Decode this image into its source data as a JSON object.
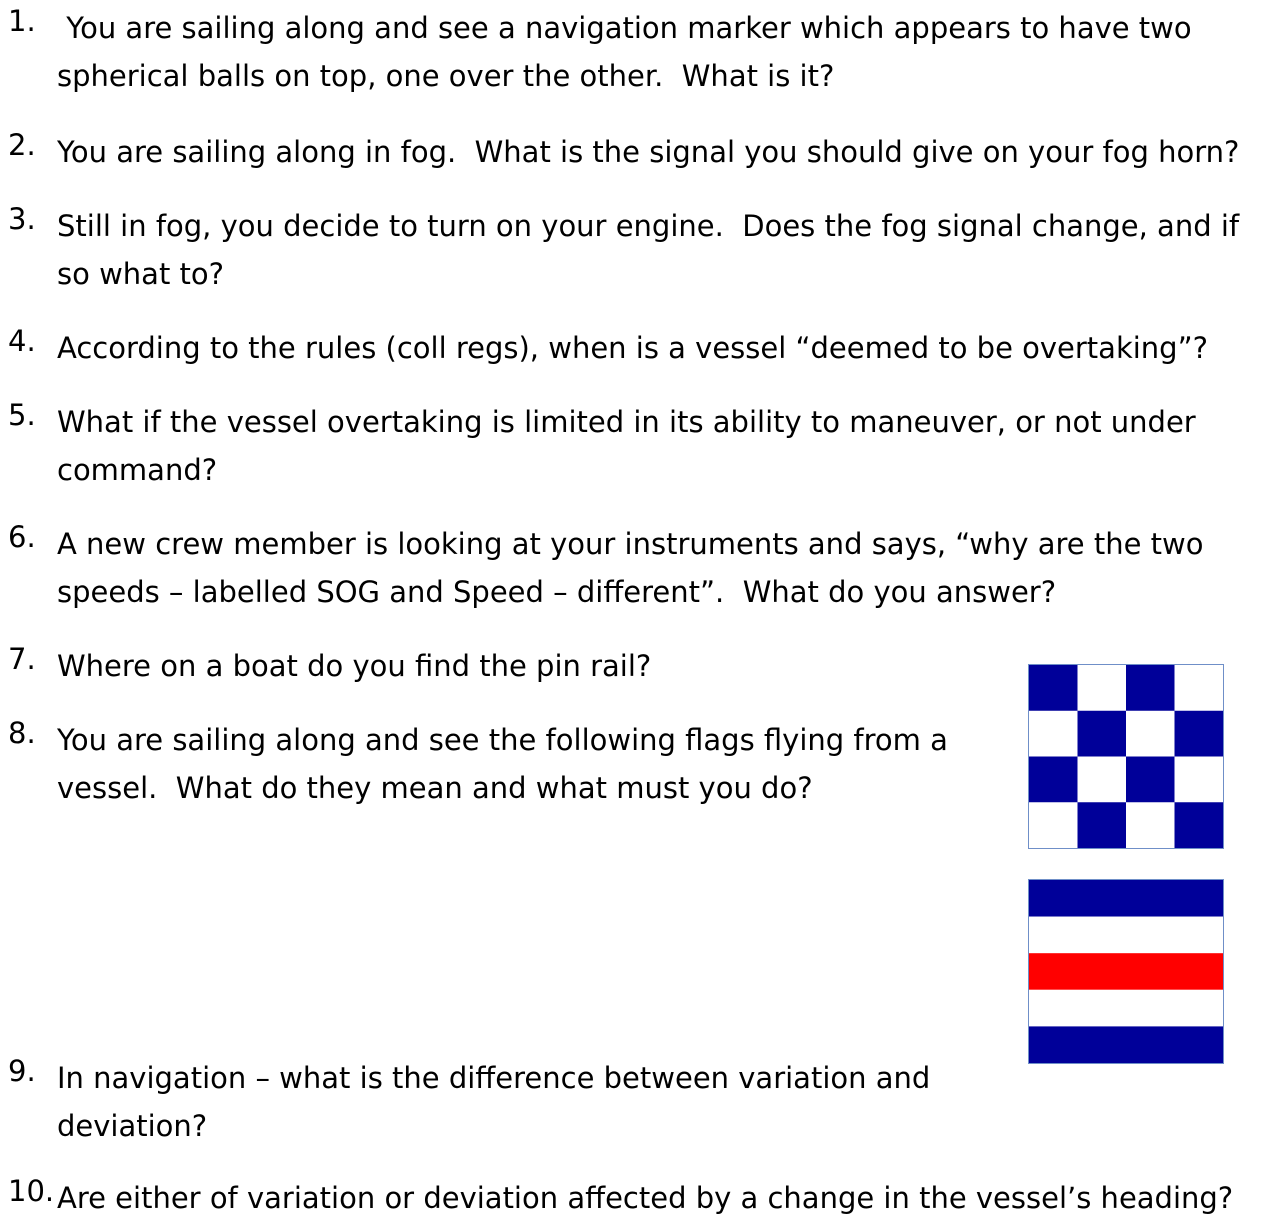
{
  "questions": [
    {
      "number": "1.",
      "lines": [
        " You are sailing along and see a navigation marker which appears to have two",
        "spherical balls on top, one over the other.  What is it?"
      ]
    },
    {
      "number": "2.",
      "lines": [
        "You are sailing along in fog.  What is the signal you should give on your fog horn?"
      ]
    },
    {
      "number": "3.",
      "lines": [
        "Still in fog, you decide to turn on your engine.  Does the fog signal change, and if",
        "so what to?"
      ]
    },
    {
      "number": "4.",
      "lines": [
        "According to the rules (coll regs), when is a vessel “deemed to be overtaking”?"
      ]
    },
    {
      "number": "5.",
      "lines": [
        "What if the vessel overtaking is limited in its ability to maneuver, or not under",
        "command?"
      ]
    },
    {
      "number": "6.",
      "lines": [
        "A new crew member is looking at your instruments and says, “why are the two",
        "speeds – labelled SOG and Speed – different”.  What do you answer?"
      ]
    },
    {
      "number": "7.",
      "lines": [
        "Where on a boat do you find the pin rail?"
      ]
    },
    {
      "number": "8.",
      "lines": [
        "You are sailing along and see the following flags flying from a",
        "vessel.  What do they mean and what must you do?"
      ]
    },
    {
      "number": "9.",
      "lines": [
        "In navigation – what is the difference between variation and",
        "deviation?"
      ]
    },
    {
      "number": "10.",
      "lines": [
        "Are either of variation or deviation affected by a change in the vessel’s heading?"
      ]
    }
  ],
  "flags": {
    "checkered": {
      "name": "signal-flag-n-checkered",
      "colors": [
        "#000099",
        "#ffffff"
      ]
    },
    "striped": {
      "name": "signal-flag-c-striped",
      "colors": [
        "#000099",
        "#ffffff",
        "#ff0000"
      ]
    }
  }
}
